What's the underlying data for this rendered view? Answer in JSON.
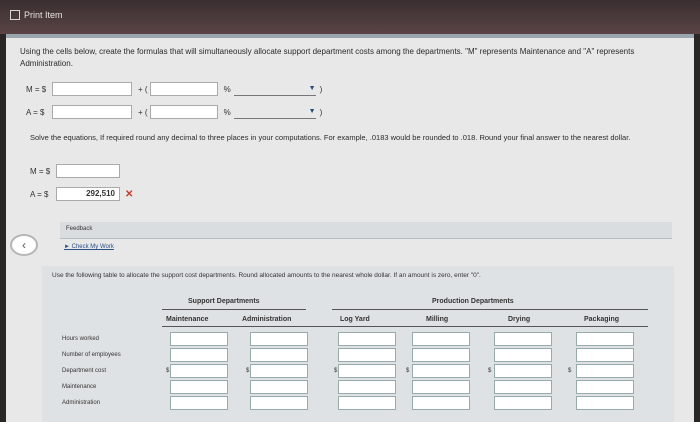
{
  "window": {
    "title": "Print Item"
  },
  "instructions": {
    "line": "Using the cells below, create the formulas that will simultaneously allocate support department costs among the departments. \"M\" represents Maintenance and \"A\" represents Administration."
  },
  "formula_rows": [
    {
      "label": "M = $",
      "plus": "+ (",
      "pct": "%",
      "close": ")"
    },
    {
      "label": "A = $",
      "plus": "+ (",
      "pct": "%",
      "close": ")"
    }
  ],
  "solve": {
    "text": "Solve the equations, If required round any decimal to three places in your computations. For example, .0183 would be rounded to .018. Round your final answer to the nearest dollar.",
    "m_label": "M = $",
    "a_label": "A = $",
    "a_value": "292,510",
    "a_mark": "✕"
  },
  "feedback": {
    "label": "Feedback",
    "check_my_work": "► Check My Work"
  },
  "table": {
    "intro": "Use the following table to allocate the support cost departments. Round allocated amounts to the nearest whole dollar. If an amount is zero, enter \"0\".",
    "group_support": "Support Departments",
    "group_production": "Production Departments",
    "columns": [
      "Maintenance",
      "Administration",
      "Log Yard",
      "Milling",
      "Drying",
      "Packaging"
    ],
    "rows": [
      "Hours worked",
      "Number of employees",
      "Department cost",
      "Maintenance",
      "Administration"
    ],
    "currency": "$"
  },
  "colors": {
    "error": "#c73c2f",
    "link": "#2b4f86"
  }
}
